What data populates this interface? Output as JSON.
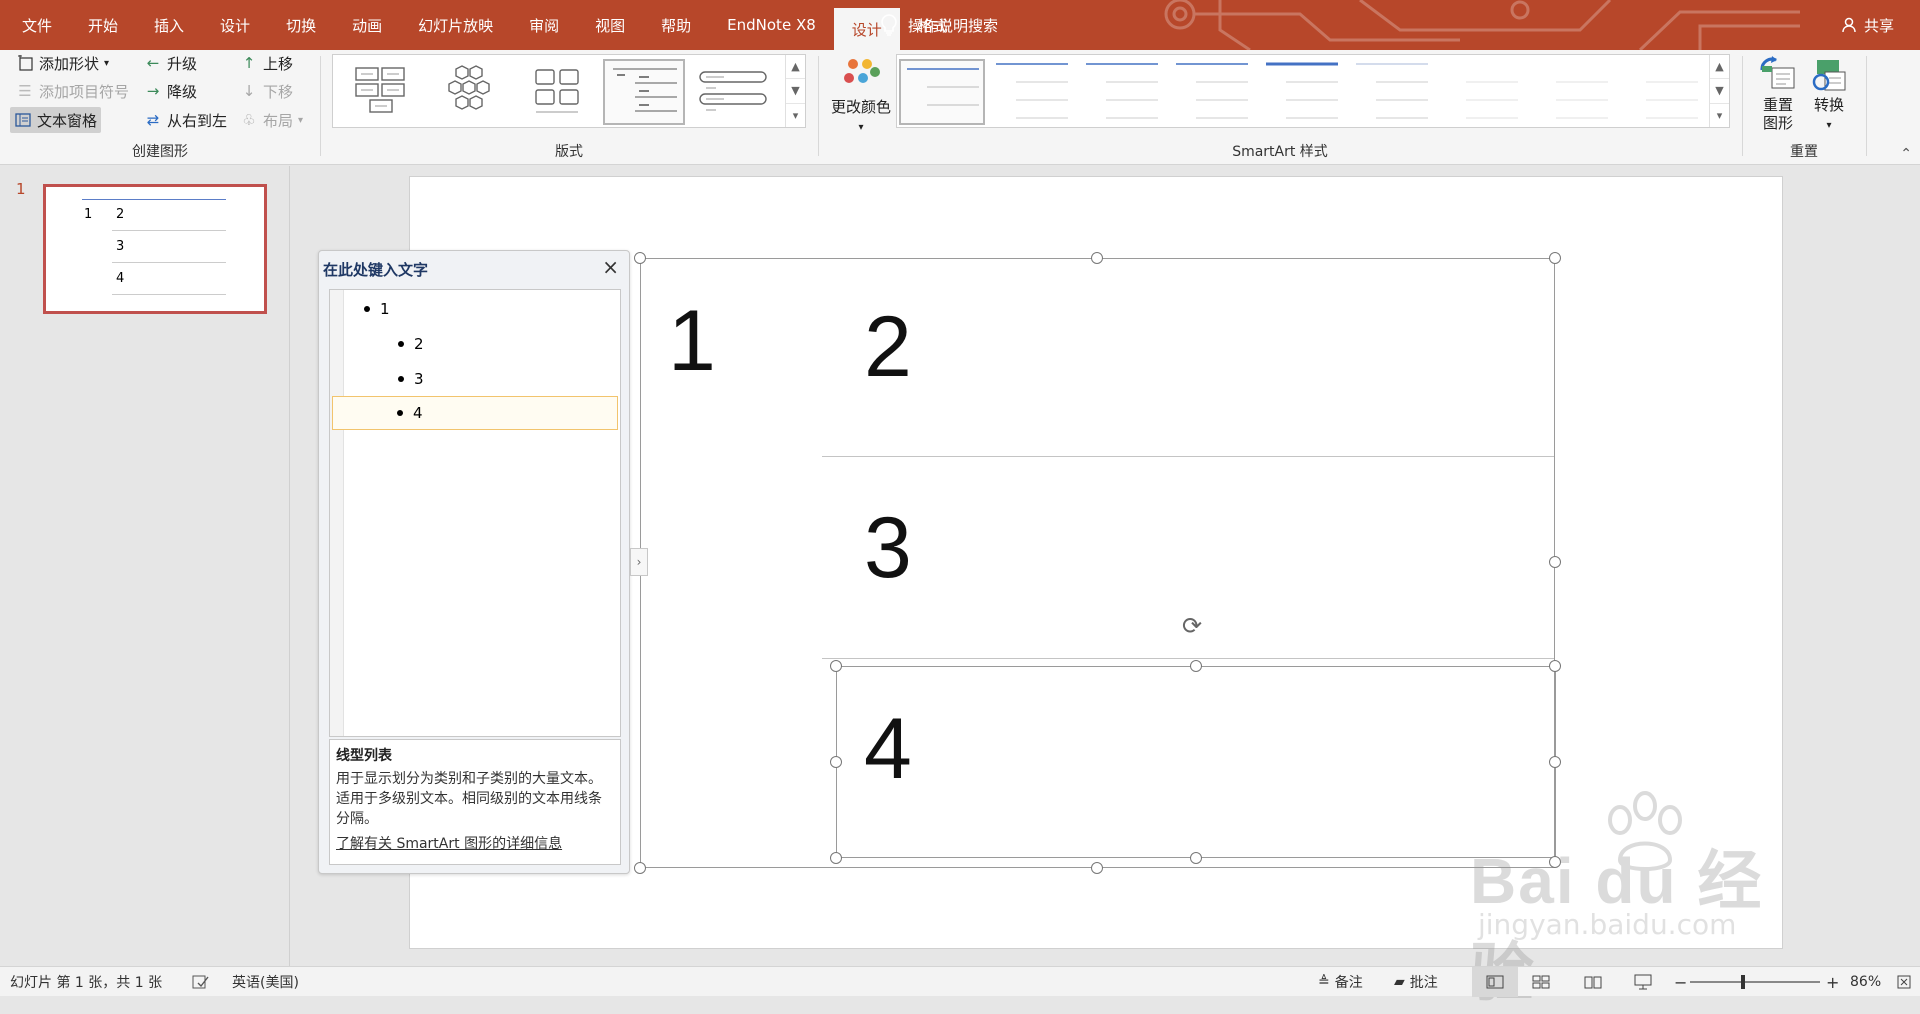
{
  "topbar": {
    "tabs": [
      {
        "label": "文件",
        "active": false
      },
      {
        "label": "开始",
        "active": false
      },
      {
        "label": "插入",
        "active": false
      },
      {
        "label": "设计",
        "active": false
      },
      {
        "label": "切换",
        "active": false
      },
      {
        "label": "动画",
        "active": false
      },
      {
        "label": "幻灯片放映",
        "active": false
      },
      {
        "label": "审阅",
        "active": false
      },
      {
        "label": "视图",
        "active": false
      },
      {
        "label": "帮助",
        "active": false
      },
      {
        "label": "EndNote X8",
        "active": false
      },
      {
        "label": "设计",
        "active": true
      },
      {
        "label": "格式",
        "active": false
      }
    ],
    "tell_me": "操作说明搜索",
    "share": "共享",
    "colors": {
      "brand": "#b7472a",
      "ribbon": "#f5f5f5"
    }
  },
  "ribbon": {
    "create": {
      "label": "创建图形",
      "add_shape": "添加形状",
      "add_bullet": "添加项目符号",
      "text_pane": "文本窗格",
      "promote": "升级",
      "demote": "降级",
      "right_to_left": "从右到左",
      "move_up": "上移",
      "move_down": "下移",
      "layout": "布局"
    },
    "layouts": {
      "label": "版式"
    },
    "styles": {
      "label": "SmartArt 样式",
      "change_colors": "更改颜色"
    },
    "reset": {
      "label": "重置",
      "reset_graphic_l1": "重置",
      "reset_graphic_l2": "图形",
      "convert": "转换"
    }
  },
  "thumbnails": {
    "slide_number": "1",
    "thumb_items": [
      "1",
      "2",
      "3",
      "4"
    ]
  },
  "text_pane": {
    "title": "在此处键入文字",
    "items": [
      {
        "text": "1",
        "level": 1
      },
      {
        "text": "2",
        "level": 2
      },
      {
        "text": "3",
        "level": 2
      },
      {
        "text": "4",
        "level": 2,
        "selected": true
      }
    ],
    "info_title": "线型列表",
    "info_desc": "用于显示划分为类别和子类别的大量文本。适用于多级别文本。相同级别的文本用线条分隔。",
    "info_link": "了解有关 SmartArt 图形的详细信息"
  },
  "smartart": {
    "items": [
      "1",
      "2",
      "3",
      "4"
    ]
  },
  "status": {
    "slide_info": "幻灯片 第 1 张，共 1 张",
    "language": "英语(美国)",
    "notes": "备注",
    "comments": "批注",
    "zoom_minus": "−",
    "zoom_plus": "+",
    "zoom": "86%"
  },
  "watermark": {
    "big": "Bai du 经验",
    "small": "jingyan.baidu.com"
  }
}
